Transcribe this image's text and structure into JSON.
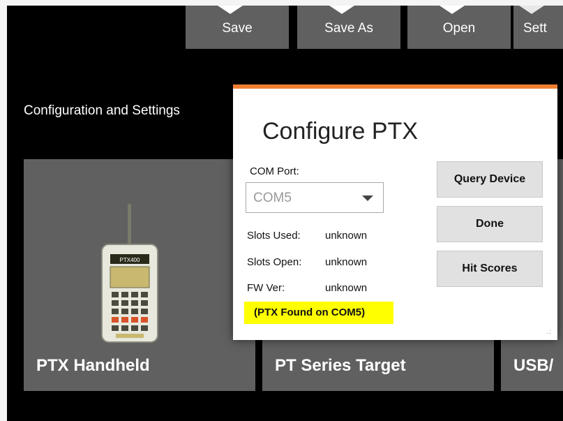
{
  "toolbar": {
    "save_label": "Save",
    "save_as_label": "Save As",
    "open_label": "Open",
    "settings_label": "Sett"
  },
  "main": {
    "heading": "Configuration and Settings",
    "tiles": [
      {
        "label": "PTX Handheld"
      },
      {
        "label": "PT Series Target"
      },
      {
        "label": "USB/"
      }
    ]
  },
  "dialog": {
    "title": "Configure PTX",
    "com_port_label": "COM Port:",
    "com_port_value": "COM5",
    "slots_used_label": "Slots Used:",
    "slots_used_value": "unknown",
    "slots_open_label": "Slots Open:",
    "slots_open_value": "unknown",
    "fw_ver_label": "FW Ver:",
    "fw_ver_value": "unknown",
    "status_message": "(PTX Found on COM5)",
    "buttons": {
      "query": "Query Device",
      "done": "Done",
      "hit_scores": "Hit Scores"
    }
  },
  "device_label": "PTX400",
  "colors": {
    "accent": "#f07f32",
    "highlight": "#ffff00",
    "tile": "#606060",
    "background": "#000000"
  }
}
